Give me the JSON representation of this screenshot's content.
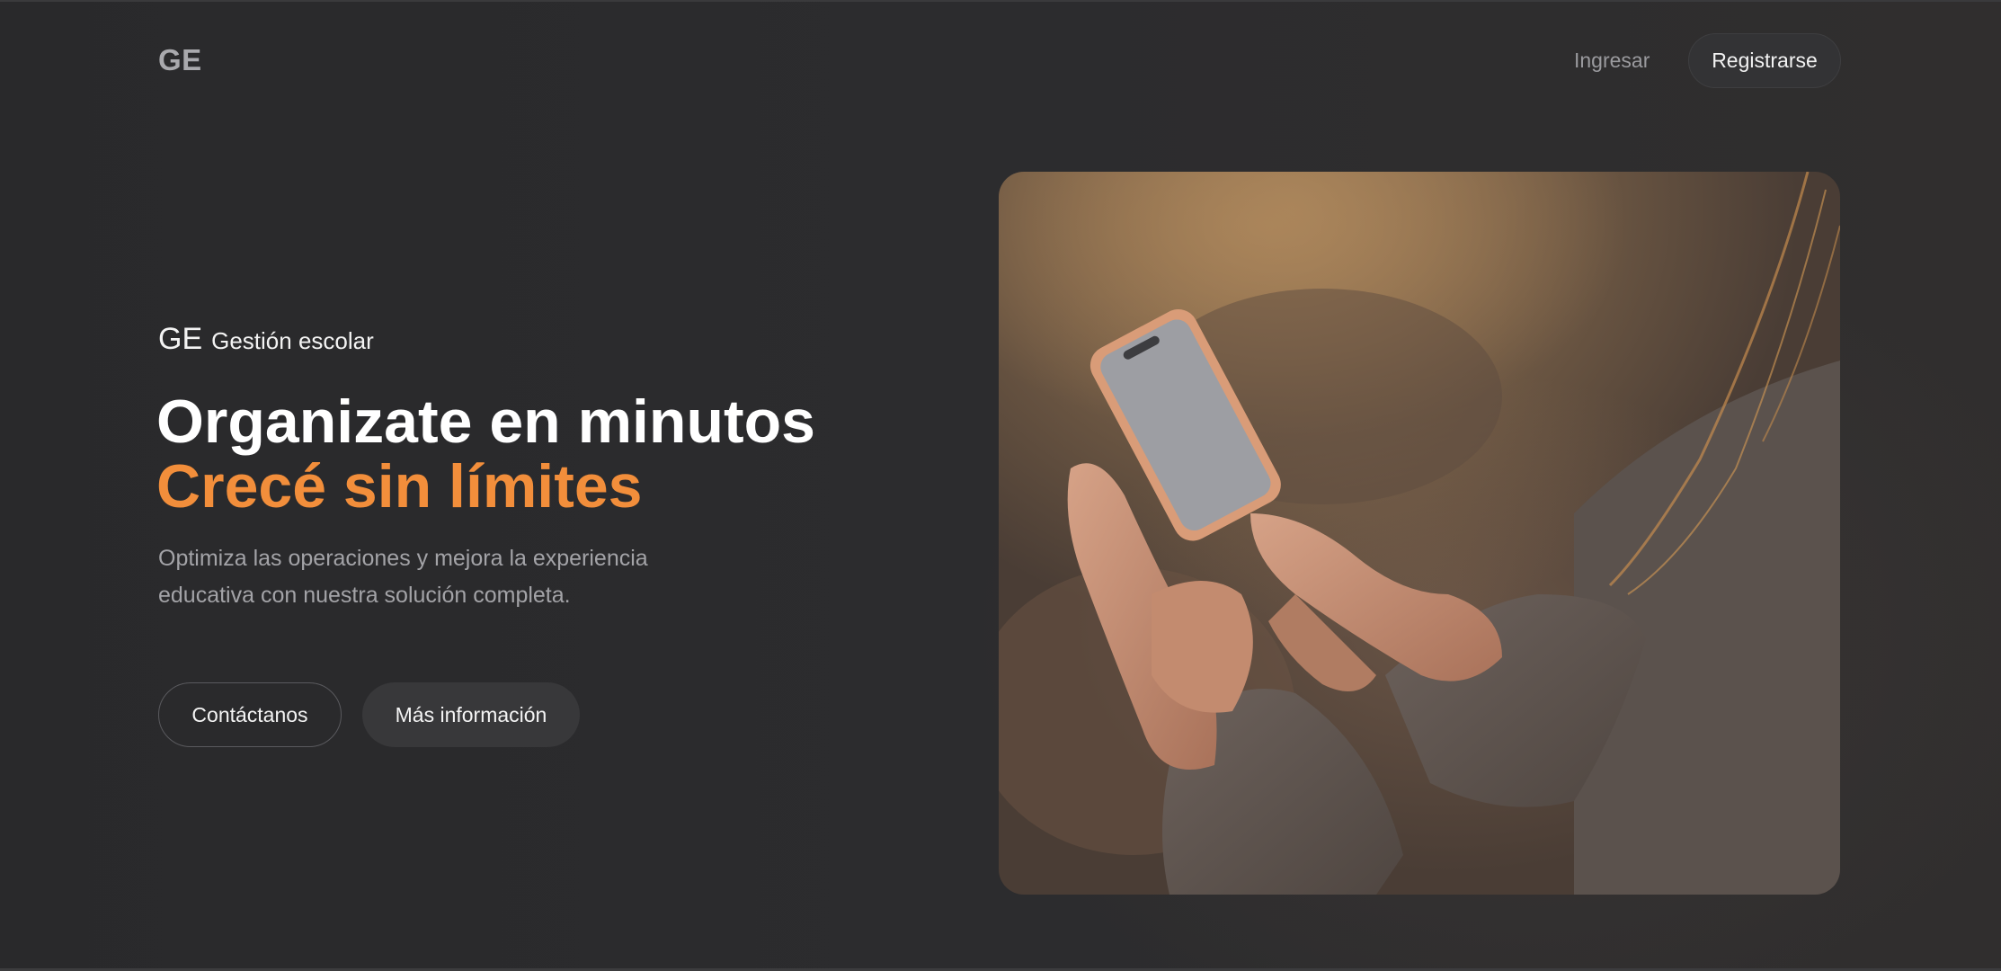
{
  "header": {
    "logo": "GE",
    "login_label": "Ingresar",
    "register_label": "Registrarse"
  },
  "hero": {
    "brand_abbr": "GE",
    "brand_name": "Gestión escolar",
    "headline": "Organizate en minutos",
    "headline_accent": "Crecé sin límites",
    "description": "Optimiza las operaciones y mejora la experiencia educativa con nuestra solución completa.",
    "contact_label": "Contáctanos",
    "info_label": "Más información",
    "image_subject": "hands holding smartphone at sunset"
  },
  "colors": {
    "background": "#2b2b2d",
    "accent": "#f28e3b",
    "text_primary": "#ffffff",
    "text_muted": "#a3a3a7"
  }
}
